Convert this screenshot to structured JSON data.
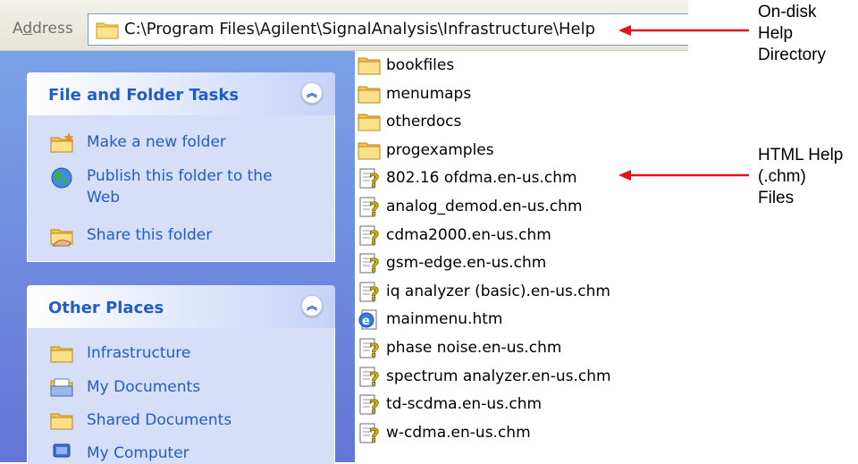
{
  "address_bar": {
    "label": "Address",
    "path": "C:\\Program Files\\Agilent\\SignalAnalysis\\Infrastructure\\Help"
  },
  "file_and_folder_tasks": {
    "title": "File and Folder Tasks",
    "items": [
      {
        "label": "Make a new folder",
        "icon": "new-folder-icon"
      },
      {
        "label": "Publish this folder to the Web",
        "icon": "globe-icon"
      },
      {
        "label": "Share this folder",
        "icon": "share-folder-icon"
      }
    ]
  },
  "other_places": {
    "title": "Other Places",
    "items": [
      {
        "label": "Infrastructure",
        "icon": "folder-icon"
      },
      {
        "label": "My Documents",
        "icon": "my-documents-icon"
      },
      {
        "label": "Shared Documents",
        "icon": "folder-icon"
      },
      {
        "label": "My Computer",
        "icon": "computer-icon"
      }
    ]
  },
  "files": [
    {
      "name": "bookfiles",
      "type": "folder"
    },
    {
      "name": "menumaps",
      "type": "folder"
    },
    {
      "name": "otherdocs",
      "type": "folder"
    },
    {
      "name": "progexamples",
      "type": "folder"
    },
    {
      "name": "802.16 ofdma.en-us.chm",
      "type": "chm"
    },
    {
      "name": "analog_demod.en-us.chm",
      "type": "chm"
    },
    {
      "name": "cdma2000.en-us.chm",
      "type": "chm"
    },
    {
      "name": "gsm-edge.en-us.chm",
      "type": "chm"
    },
    {
      "name": "iq analyzer (basic).en-us.chm",
      "type": "chm"
    },
    {
      "name": "mainmenu.htm",
      "type": "htm"
    },
    {
      "name": "phase noise.en-us.chm",
      "type": "chm"
    },
    {
      "name": "spectrum analyzer.en-us.chm",
      "type": "chm"
    },
    {
      "name": "td-scdma.en-us.chm",
      "type": "chm"
    },
    {
      "name": "w-cdma.en-us.chm",
      "type": "chm"
    }
  ],
  "annotations": {
    "on_disk": [
      "On-disk",
      "Help",
      "Directory"
    ],
    "html_help": [
      "HTML Help",
      "(.chm)",
      "Files"
    ],
    "arrow_color": "#e8101a"
  },
  "colors": {
    "task_pane_top": "#7ba2e7",
    "task_pane_bottom": "#6375d6",
    "panel_title": "#215dc6",
    "panel_body": "#d6dff7"
  }
}
